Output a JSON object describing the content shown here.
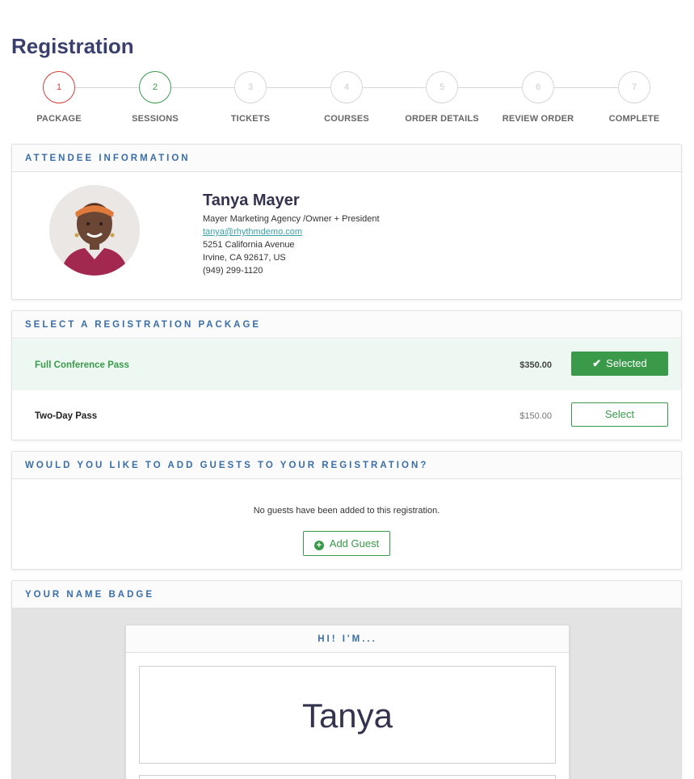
{
  "page": {
    "title": "Registration"
  },
  "steps": [
    {
      "num": "1",
      "label": "PACKAGE",
      "state": "active"
    },
    {
      "num": "2",
      "label": "SESSIONS",
      "state": "current"
    },
    {
      "num": "3",
      "label": "TICKETS",
      "state": "pending"
    },
    {
      "num": "4",
      "label": "COURSES",
      "state": "pending"
    },
    {
      "num": "5",
      "label": "ORDER DETAILS",
      "state": "pending"
    },
    {
      "num": "6",
      "label": "REVIEW ORDER",
      "state": "pending"
    },
    {
      "num": "7",
      "label": "COMPLETE",
      "state": "pending"
    }
  ],
  "attendee": {
    "header": "ATTENDEE INFORMATION",
    "name": "Tanya Mayer",
    "company": "Mayer Marketing Agency /Owner + President",
    "email": "tanya@rhythmdemo.com",
    "address1": "5251 California Avenue",
    "address2": "Irvine, CA 92617, US",
    "phone": "(949) 299-1120"
  },
  "packages": {
    "header": "SELECT A REGISTRATION PACKAGE",
    "items": [
      {
        "name": "Full Conference Pass",
        "price": "$350.00",
        "button": "Selected",
        "selected": true
      },
      {
        "name": "Two-Day Pass",
        "price": "$150.00",
        "button": "Select",
        "selected": false
      }
    ]
  },
  "guests": {
    "header": "WOULD YOU LIKE TO ADD GUESTS TO YOUR REGISTRATION?",
    "message": "No guests have been added to this registration.",
    "button": "Add Guest"
  },
  "badge": {
    "header": "YOUR NAME BADGE",
    "card_header": "HI! I'M...",
    "name": "Tanya"
  },
  "colors": {
    "accent_green": "#3a9a4a",
    "header_blue": "#3a6ea8",
    "step_red": "#d93a3a",
    "title_navy": "#3a3f6e"
  }
}
